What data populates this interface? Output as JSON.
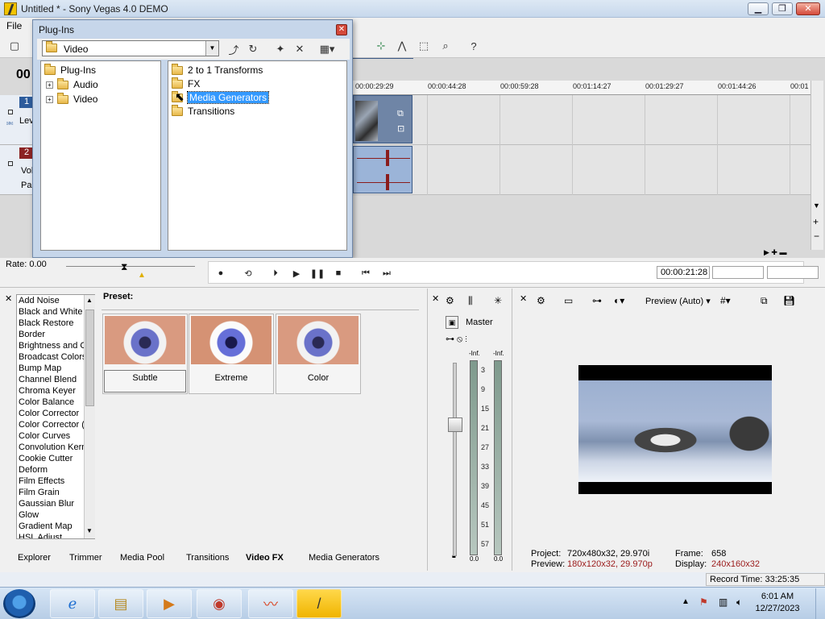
{
  "window": {
    "title": "Untitled * - Sony Vegas 4.0 DEMO"
  },
  "menu": {
    "file": "File"
  },
  "timecode": {
    "main": "00"
  },
  "ruler": {
    "labels": [
      "00:00:29:29",
      "00:00:44:28",
      "00:00:59:28",
      "00:01:14:27",
      "00:01:29:27",
      "00:01:44:26",
      "00:01"
    ]
  },
  "tracks": [
    {
      "number": "1",
      "label": "Lev"
    },
    {
      "number": "2",
      "label": "Vol",
      "label2": "Pa"
    }
  ],
  "plugins": {
    "title": "Plug-Ins",
    "combo_value": "Video",
    "tree": {
      "root": "Plug-Ins",
      "children": [
        "Audio",
        "Video"
      ]
    },
    "list": [
      "2 to 1 Transforms",
      "FX",
      "Media Generators",
      "Transitions"
    ],
    "selected_index": 2
  },
  "transport": {
    "rate_label": "Rate: 0.00",
    "time": "00:00:21:28"
  },
  "video_fx": {
    "items": [
      "Add Noise",
      "Black and White",
      "Black Restore",
      "Border",
      "Brightness and C",
      "Broadcast Colors",
      "Bump Map",
      "Channel Blend",
      "Chroma Keyer",
      "Color Balance",
      "Color Corrector",
      "Color Corrector (S",
      "Color Curves",
      "Convolution Kern",
      "Cookie Cutter",
      "Deform",
      "Film Effects",
      "Film Grain",
      "Gaussian Blur",
      "Glow",
      "Gradient Map",
      "HSL Adjust"
    ],
    "preset_label": "Preset:",
    "presets": [
      "Subtle",
      "Extreme",
      "Color"
    ]
  },
  "tabs": [
    "Explorer",
    "Trimmer",
    "Media Pool",
    "Transitions",
    "Video FX",
    "Media Generators"
  ],
  "mixer": {
    "master_label": "Master",
    "inf_left": "-Inf.",
    "inf_right": "-Inf.",
    "scale": [
      "3",
      "9",
      "15",
      "21",
      "27",
      "33",
      "39",
      "45",
      "51",
      "57"
    ],
    "bottom_left": "0.0",
    "bottom_right": "0.0"
  },
  "preview": {
    "mode": "Preview (Auto)",
    "project_label": "Project:",
    "project_value": "720x480x32, 29.970i",
    "preview_label": "Preview:",
    "preview_value": "180x120x32, 29.970p",
    "frame_label": "Frame:",
    "frame_value": "658",
    "display_label": "Display:",
    "display_value": "240x160x32"
  },
  "status": {
    "record_time": "Record Time: 33:25:35"
  },
  "taskbar": {
    "time": "6:01 AM",
    "date": "12/27/2023"
  }
}
